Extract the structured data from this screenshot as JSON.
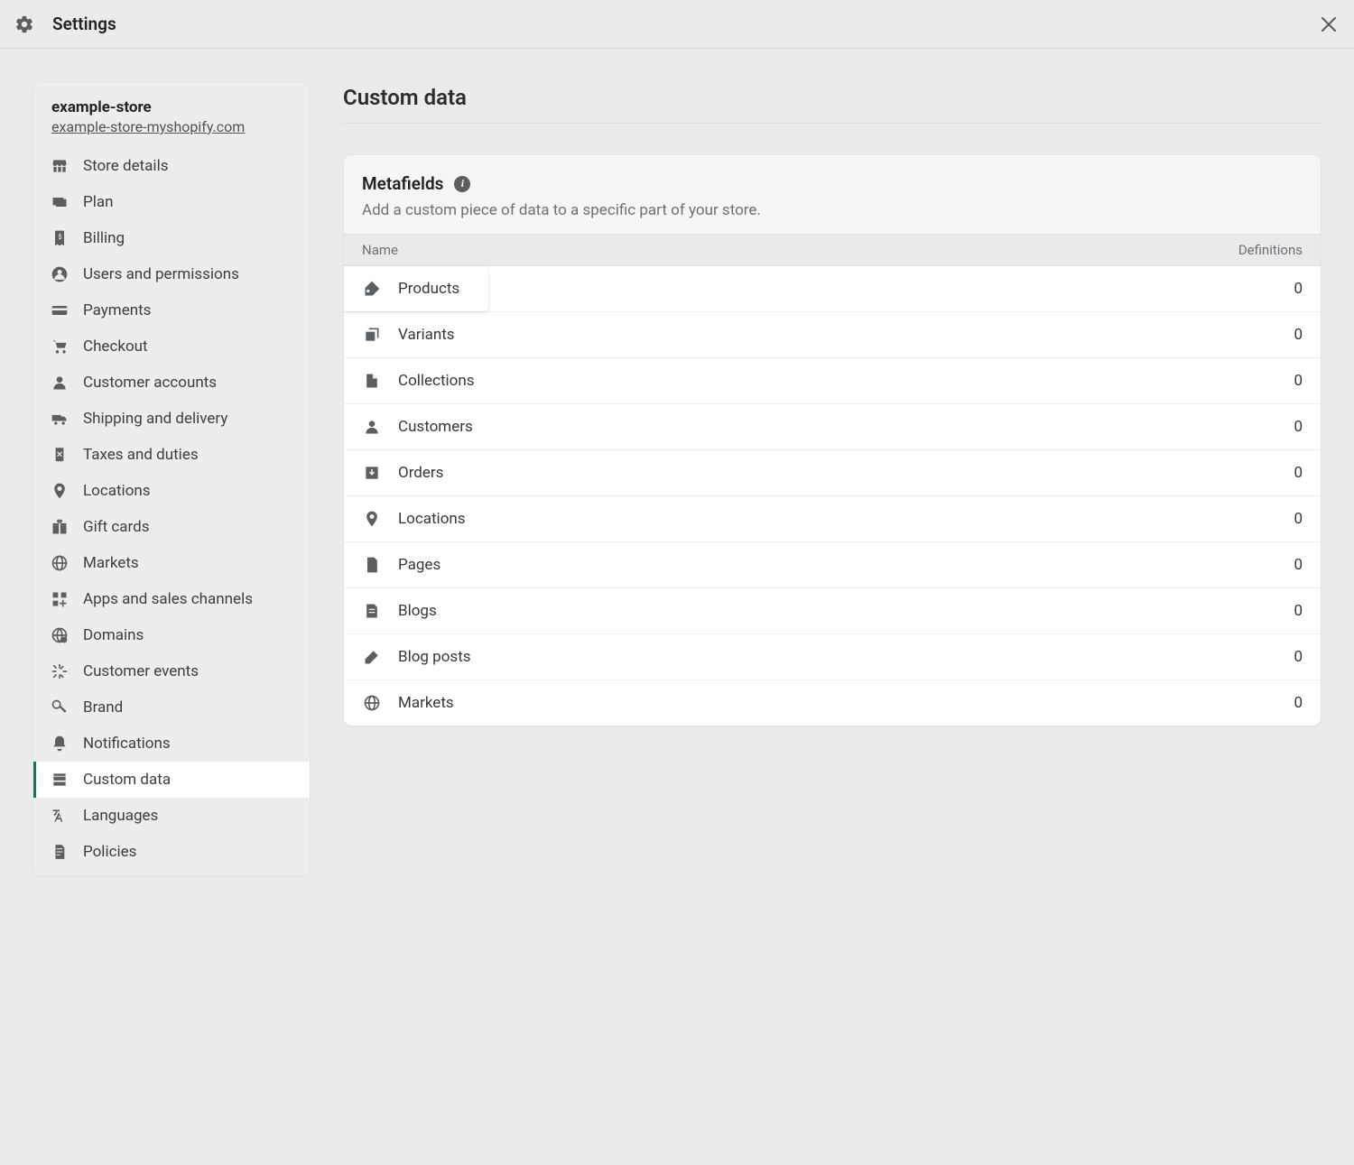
{
  "header": {
    "title": "Settings"
  },
  "store": {
    "name": "example-store",
    "domain": "example-store-myshopify.com"
  },
  "sidebar": {
    "items": [
      {
        "label": "Store details",
        "icon": "storefront-icon",
        "active": false
      },
      {
        "label": "Plan",
        "icon": "plan-icon",
        "active": false
      },
      {
        "label": "Billing",
        "icon": "receipt-icon",
        "active": false
      },
      {
        "label": "Users and permissions",
        "icon": "user-circle-icon",
        "active": false
      },
      {
        "label": "Payments",
        "icon": "credit-card-icon",
        "active": false
      },
      {
        "label": "Checkout",
        "icon": "cart-icon",
        "active": false
      },
      {
        "label": "Customer accounts",
        "icon": "person-icon",
        "active": false
      },
      {
        "label": "Shipping and delivery",
        "icon": "truck-icon",
        "active": false
      },
      {
        "label": "Taxes and duties",
        "icon": "tax-receipt-icon",
        "active": false
      },
      {
        "label": "Locations",
        "icon": "location-pin-icon",
        "active": false
      },
      {
        "label": "Gift cards",
        "icon": "gift-icon",
        "active": false
      },
      {
        "label": "Markets",
        "icon": "globe-icon",
        "active": false
      },
      {
        "label": "Apps and sales channels",
        "icon": "apps-grid-icon",
        "active": false
      },
      {
        "label": "Domains",
        "icon": "domain-globe-icon",
        "active": false
      },
      {
        "label": "Customer events",
        "icon": "spark-icon",
        "active": false
      },
      {
        "label": "Brand",
        "icon": "brand-flag-icon",
        "active": false
      },
      {
        "label": "Notifications",
        "icon": "bell-icon",
        "active": false
      },
      {
        "label": "Custom data",
        "icon": "database-icon",
        "active": true
      },
      {
        "label": "Languages",
        "icon": "translate-icon",
        "active": false
      },
      {
        "label": "Policies",
        "icon": "policy-doc-icon",
        "active": false
      }
    ]
  },
  "main": {
    "title": "Custom data",
    "metafields": {
      "title": "Metafields",
      "subtitle": "Add a custom piece of data to a specific part of your store.",
      "columns": {
        "name": "Name",
        "definitions": "Definitions"
      },
      "rows": [
        {
          "label": "Products",
          "icon": "tag-icon",
          "count": 0,
          "highlight": true
        },
        {
          "label": "Variants",
          "icon": "variant-icon",
          "count": 0,
          "highlight": false
        },
        {
          "label": "Collections",
          "icon": "collection-icon",
          "count": 0,
          "highlight": false
        },
        {
          "label": "Customers",
          "icon": "person-icon",
          "count": 0,
          "highlight": false
        },
        {
          "label": "Orders",
          "icon": "order-inbox-icon",
          "count": 0,
          "highlight": false
        },
        {
          "label": "Locations",
          "icon": "location-pin-icon",
          "count": 0,
          "highlight": false
        },
        {
          "label": "Pages",
          "icon": "page-icon",
          "count": 0,
          "highlight": false
        },
        {
          "label": "Blogs",
          "icon": "blog-icon",
          "count": 0,
          "highlight": false
        },
        {
          "label": "Blog posts",
          "icon": "pencil-icon",
          "count": 0,
          "highlight": false
        },
        {
          "label": "Markets",
          "icon": "globe-icon",
          "count": 0,
          "highlight": false
        }
      ]
    }
  }
}
